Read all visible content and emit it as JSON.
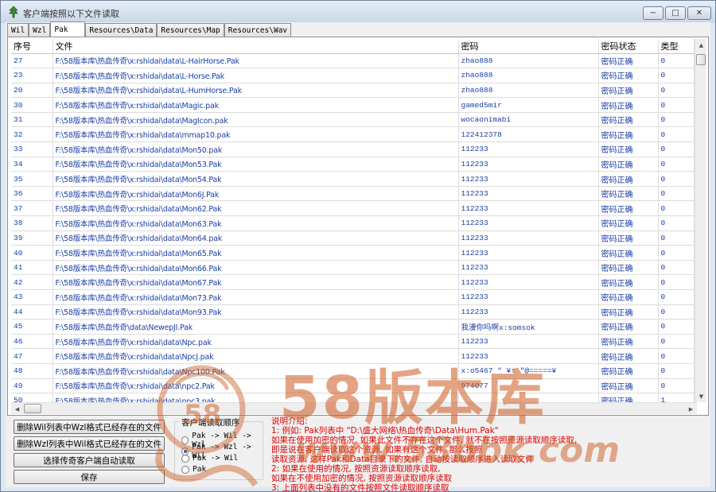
{
  "window": {
    "title": "客户端按照以下文件读取",
    "minimize_glyph": "−",
    "maximize_glyph": "□",
    "close_glyph": "✕"
  },
  "tabs": [
    "Wil",
    "Wzl",
    "Pak",
    "Resources\\Data",
    "Resources\\Map",
    "Resources\\Wav"
  ],
  "active_tab": "Pak",
  "table": {
    "columns": [
      "序号",
      "文件",
      "密码",
      "密码状态",
      "类型"
    ],
    "rows": [
      [
        "27",
        "F:\\58版本库\\热血传奇\\x:rshidai\\data\\L-HairHorse.Pak",
        "zhao888",
        "密码正确",
        "0"
      ],
      [
        "23",
        "F:\\58版本库\\热血传奇\\x:rshidai\\data\\L-Horse.Pak",
        "zhao888",
        "密码正确",
        "0"
      ],
      [
        "20",
        "F:\\58版本库\\热血传奇\\x:rshidai\\data\\L-HumHorse.Pak",
        "zhao888",
        "密码正确",
        "0"
      ],
      [
        "30",
        "F:\\58版本库\\热血传奇\\x:rshidai\\data\\Magic.pak",
        "gamed5mir",
        "密码正确",
        "0"
      ],
      [
        "31",
        "F:\\58版本库\\热血传奇\\x:rshidai\\data\\MagIcon.pak",
        "wocaonimabi",
        "密码正确",
        "0"
      ],
      [
        "32",
        "F:\\58版本库\\热血传奇\\x:rshidai\\data\\mmap10.pak",
        "122412378",
        "密码正确",
        "0"
      ],
      [
        "33",
        "F:\\58版本库\\热血传奇\\x:rshidai\\data\\Mon50.pak",
        "112233",
        "密码正确",
        "0"
      ],
      [
        "34",
        "F:\\58版本库\\热血传奇\\x:rshidai\\data\\Mon53.Pak",
        "112233",
        "密码正确",
        "0"
      ],
      [
        "35",
        "F:\\58版本库\\热血传奇\\x:rshidai\\data\\Mon54.Pak",
        "112233",
        "密码正确",
        "0"
      ],
      [
        "36",
        "F:\\58版本库\\热血传奇\\x:rshidai\\data\\Mon6J.Pak",
        "112233",
        "密码正确",
        "0"
      ],
      [
        "37",
        "F:\\58版本库\\热血传奇\\x:rshidai\\data\\Mon62.Pak",
        "112233",
        "密码正确",
        "0"
      ],
      [
        "38",
        "F:\\58版本库\\热血传奇\\x:rshidai\\data\\Mon63.Pak",
        "112233",
        "密码正确",
        "0"
      ],
      [
        "39",
        "F:\\58版本库\\热血传奇\\x:rshidai\\data\\Mon64.pak",
        "112233",
        "密码正确",
        "0"
      ],
      [
        "40",
        "F:\\58版本库\\热血传奇\\x:rshidai\\data\\Mon65.Pak",
        "112233",
        "密码正确",
        "0"
      ],
      [
        "41",
        "F:\\58版本库\\热血传奇\\x:rshidai\\data\\Mon66.Pak",
        "112233",
        "密码正确",
        "0"
      ],
      [
        "42",
        "F:\\58版本库\\热血传奇\\x:rshidai\\data\\Mon67.Pak",
        "112233",
        "密码正确",
        "0"
      ],
      [
        "43",
        "F:\\58版本库\\热血传奇\\x:rshidai\\data\\Mon73.Pak",
        "112233",
        "密码正确",
        "0"
      ],
      [
        "44",
        "F:\\58版本库\\热血传奇\\x:rshidai\\data\\Mon93.Pak",
        "112233",
        "密码正确",
        "0"
      ],
      [
        "45",
        "F:\\58版本库\\热血传奇\\data\\NewepJI.Pak",
        "我漫你吗啊x:somsok",
        "密码正确",
        "0"
      ],
      [
        "46",
        "F:\\58版本库\\热血传奇\\x:rshidai\\data\\Npc.pak",
        "112233",
        "密码正确",
        "0"
      ],
      [
        "47",
        "F:\\58版本库\\热血传奇\\x:rshidai\\data\\NpcJ.pak",
        "112233",
        "密码正确",
        "0"
      ],
      [
        "48",
        "F:\\58版本库\\热血传奇\\x:rshidai\\data\\Npc100.Pak",
        "x:o5467 \" ¥: \"@=====¥",
        "密码正确",
        "0"
      ],
      [
        "49",
        "F:\\58版本库\\热血传奇\\x:rshidai\\data\\npc2.Pak",
        "974077",
        "密码正确",
        "0"
      ],
      [
        "50",
        "F:\\58版本库\\热血传奇\\x:rshidai\\data\\npc3.pak",
        "",
        "密码正确",
        "1"
      ]
    ]
  },
  "buttons": {
    "delete_wil": "删除Wil列表中Wzl格式已经存在的文件",
    "delete_wzl": "删除Wzl列表中Wil格式已经存在的文件",
    "auto_read": "选择传奇客户端自动读取",
    "save": "保存"
  },
  "read_order": {
    "title": "客户端读取顺序",
    "options": [
      "Pak -> Wil -> Wzl",
      "Pak -> Wzl -> Wil",
      "Pak -> Wil",
      "Pak"
    ],
    "selected_index": 1
  },
  "notes": {
    "heading": "说明介绍:",
    "lines": [
      "1: 例如: Pak列表中 \"D:\\盛大网络\\热血传奇\\Data\\Hum.Pak\"",
      "   如果在使用加密的情况, 如果此文件不存在这个文件, 就不在按照资源读取顺序读取,",
      "   即是说在客户端读取这个资源, 如果有这个文件, 那么按照",
      "   读取资源, 这样Pak和Data目录下的文件, 自动按读取顺序进入读取文件",
      "2: 如果在使用的情况, 按照资源读取顺序读取,",
      "   如果在不使用加密的情况, 按照资源读取顺序读取",
      "3: 上面列表中没有的文件按照文件读取顺序读取"
    ]
  },
  "watermark": {
    "brand": "58版本库",
    "url": "www.58bbk.com",
    "logo_text": "58"
  },
  "colors": {
    "accent_blue": "#1a3ea6",
    "note_red": "#e00000",
    "watermark_orange": "#cd5a1e"
  },
  "icons": {
    "app": "tree-icon",
    "minimize": "minimize-icon",
    "maximize": "maximize-icon",
    "close": "close-icon"
  }
}
